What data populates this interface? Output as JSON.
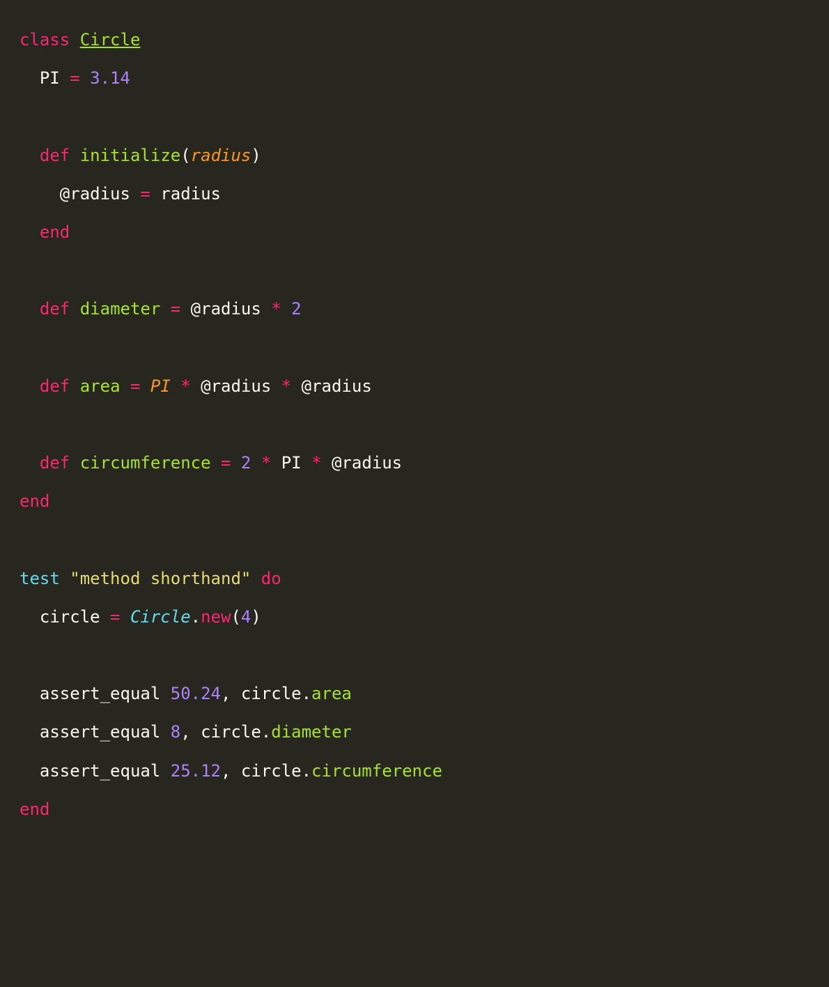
{
  "code": {
    "lines": [
      [
        {
          "cls": "tok-keyword",
          "t": "class"
        },
        {
          "cls": "tok-plain",
          "t": " "
        },
        {
          "cls": "tok-classdef",
          "t": "Circle"
        }
      ],
      [
        {
          "cls": "tok-plain",
          "t": "  PI "
        },
        {
          "cls": "tok-op",
          "t": "="
        },
        {
          "cls": "tok-plain",
          "t": " "
        },
        {
          "cls": "tok-number",
          "t": "3.14"
        }
      ],
      [],
      [
        {
          "cls": "tok-plain",
          "t": "  "
        },
        {
          "cls": "tok-keyword",
          "t": "def"
        },
        {
          "cls": "tok-plain",
          "t": " "
        },
        {
          "cls": "tok-method",
          "t": "initialize"
        },
        {
          "cls": "tok-plain",
          "t": "("
        },
        {
          "cls": "tok-param",
          "t": "radius"
        },
        {
          "cls": "tok-plain",
          "t": ")"
        }
      ],
      [
        {
          "cls": "tok-plain",
          "t": "    @radius "
        },
        {
          "cls": "tok-op",
          "t": "="
        },
        {
          "cls": "tok-plain",
          "t": " radius"
        }
      ],
      [
        {
          "cls": "tok-plain",
          "t": "  "
        },
        {
          "cls": "tok-keyword",
          "t": "end"
        }
      ],
      [],
      [
        {
          "cls": "tok-plain",
          "t": "  "
        },
        {
          "cls": "tok-keyword",
          "t": "def"
        },
        {
          "cls": "tok-plain",
          "t": " "
        },
        {
          "cls": "tok-method",
          "t": "diameter"
        },
        {
          "cls": "tok-plain",
          "t": " "
        },
        {
          "cls": "tok-op",
          "t": "="
        },
        {
          "cls": "tok-plain",
          "t": " @radius "
        },
        {
          "cls": "tok-op",
          "t": "*"
        },
        {
          "cls": "tok-plain",
          "t": " "
        },
        {
          "cls": "tok-number",
          "t": "2"
        }
      ],
      [],
      [
        {
          "cls": "tok-plain",
          "t": "  "
        },
        {
          "cls": "tok-keyword",
          "t": "def"
        },
        {
          "cls": "tok-plain",
          "t": " "
        },
        {
          "cls": "tok-method",
          "t": "area"
        },
        {
          "cls": "tok-plain",
          "t": " "
        },
        {
          "cls": "tok-op",
          "t": "="
        },
        {
          "cls": "tok-plain",
          "t": " "
        },
        {
          "cls": "tok-const",
          "t": "PI"
        },
        {
          "cls": "tok-plain",
          "t": " "
        },
        {
          "cls": "tok-op",
          "t": "*"
        },
        {
          "cls": "tok-plain",
          "t": " @radius "
        },
        {
          "cls": "tok-op",
          "t": "*"
        },
        {
          "cls": "tok-plain",
          "t": " @radius"
        }
      ],
      [],
      [
        {
          "cls": "tok-plain",
          "t": "  "
        },
        {
          "cls": "tok-keyword",
          "t": "def"
        },
        {
          "cls": "tok-plain",
          "t": " "
        },
        {
          "cls": "tok-method",
          "t": "circumference"
        },
        {
          "cls": "tok-plain",
          "t": " "
        },
        {
          "cls": "tok-op",
          "t": "="
        },
        {
          "cls": "tok-plain",
          "t": " "
        },
        {
          "cls": "tok-number",
          "t": "2"
        },
        {
          "cls": "tok-plain",
          "t": " "
        },
        {
          "cls": "tok-op",
          "t": "*"
        },
        {
          "cls": "tok-plain",
          "t": " PI "
        },
        {
          "cls": "tok-op",
          "t": "*"
        },
        {
          "cls": "tok-plain",
          "t": " @radius"
        }
      ],
      [
        {
          "cls": "tok-keyword",
          "t": "end"
        }
      ],
      [],
      [
        {
          "cls": "tok-funcname",
          "t": "test"
        },
        {
          "cls": "tok-plain",
          "t": " "
        },
        {
          "cls": "tok-string",
          "t": "\"method shorthand\""
        },
        {
          "cls": "tok-plain",
          "t": " "
        },
        {
          "cls": "tok-keyword",
          "t": "do"
        }
      ],
      [
        {
          "cls": "tok-plain",
          "t": "  circle "
        },
        {
          "cls": "tok-op",
          "t": "="
        },
        {
          "cls": "tok-plain",
          "t": " "
        },
        {
          "cls": "tok-classref",
          "t": "Circle"
        },
        {
          "cls": "tok-plain",
          "t": "."
        },
        {
          "cls": "tok-keyword",
          "t": "new"
        },
        {
          "cls": "tok-plain",
          "t": "("
        },
        {
          "cls": "tok-number",
          "t": "4"
        },
        {
          "cls": "tok-plain",
          "t": ")"
        }
      ],
      [],
      [
        {
          "cls": "tok-plain",
          "t": "  assert_equal "
        },
        {
          "cls": "tok-number",
          "t": "50.24"
        },
        {
          "cls": "tok-plain",
          "t": ", circle."
        },
        {
          "cls": "tok-method",
          "t": "area"
        }
      ],
      [
        {
          "cls": "tok-plain",
          "t": "  assert_equal "
        },
        {
          "cls": "tok-number",
          "t": "8"
        },
        {
          "cls": "tok-plain",
          "t": ", circle."
        },
        {
          "cls": "tok-method",
          "t": "diameter"
        }
      ],
      [
        {
          "cls": "tok-plain",
          "t": "  assert_equal "
        },
        {
          "cls": "tok-number",
          "t": "25.12"
        },
        {
          "cls": "tok-plain",
          "t": ", circle."
        },
        {
          "cls": "tok-method",
          "t": "circumference"
        }
      ],
      [
        {
          "cls": "tok-keyword",
          "t": "end"
        }
      ]
    ]
  }
}
